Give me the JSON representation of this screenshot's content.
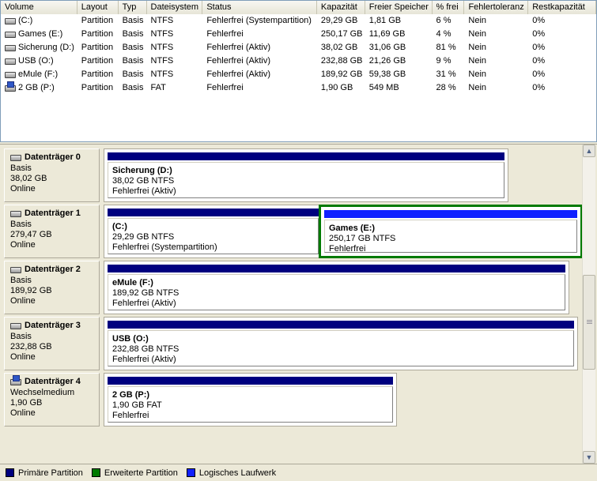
{
  "volumes": {
    "columns": [
      "Volume",
      "Layout",
      "Typ",
      "Dateisystem",
      "Status",
      "Kapazität",
      "Freier Speicher",
      "% frei",
      "Fehlertoleranz",
      "Restkapazität"
    ],
    "rows": [
      {
        "name": "(C:)",
        "icon": "hard-drive-icon",
        "layout": "Partition",
        "type": "Basis",
        "fs": "NTFS",
        "status": "Fehlerfrei (Systempartition)",
        "capacity": "29,29 GB",
        "free": "1,81 GB",
        "pct": "6 %",
        "fault": "Nein",
        "overhead": "0%"
      },
      {
        "name": "Games (E:)",
        "icon": "hard-drive-icon",
        "layout": "Partition",
        "type": "Basis",
        "fs": "NTFS",
        "status": "Fehlerfrei",
        "capacity": "250,17 GB",
        "free": "11,69 GB",
        "pct": "4 %",
        "fault": "Nein",
        "overhead": "0%"
      },
      {
        "name": "Sicherung (D:)",
        "icon": "hard-drive-icon",
        "layout": "Partition",
        "type": "Basis",
        "fs": "NTFS",
        "status": "Fehlerfrei (Aktiv)",
        "capacity": "38,02 GB",
        "free": "31,06 GB",
        "pct": "81 %",
        "fault": "Nein",
        "overhead": "0%"
      },
      {
        "name": "USB (O:)",
        "icon": "hard-drive-icon",
        "layout": "Partition",
        "type": "Basis",
        "fs": "NTFS",
        "status": "Fehlerfrei (Aktiv)",
        "capacity": "232,88 GB",
        "free": "21,26 GB",
        "pct": "9 %",
        "fault": "Nein",
        "overhead": "0%"
      },
      {
        "name": "eMule (F:)",
        "icon": "hard-drive-icon",
        "layout": "Partition",
        "type": "Basis",
        "fs": "NTFS",
        "status": "Fehlerfrei (Aktiv)",
        "capacity": "189,92 GB",
        "free": "59,38 GB",
        "pct": "31 %",
        "fault": "Nein",
        "overhead": "0%"
      },
      {
        "name": "2 GB (P:)",
        "icon": "removable-drive-icon",
        "layout": "Partition",
        "type": "Basis",
        "fs": "FAT",
        "status": "Fehlerfrei",
        "capacity": "1,90 GB",
        "free": "549 MB",
        "pct": "28 %",
        "fault": "Nein",
        "overhead": "0%"
      }
    ]
  },
  "disks": [
    {
      "title": "Datenträger 0",
      "icon": "hard-drive-icon",
      "kind": "Basis",
      "size": "38,02 GB",
      "state": "Online",
      "partitions": [
        {
          "name": "Sicherung  (D:)",
          "size": "38,02 GB NTFS",
          "status": "Fehlerfrei (Aktiv)",
          "kind": "primary"
        }
      ]
    },
    {
      "title": "Datenträger 1",
      "icon": "hard-drive-icon",
      "kind": "Basis",
      "size": "279,47 GB",
      "state": "Online",
      "partitions": [
        {
          "name": "(C:)",
          "size": "29,29 GB NTFS",
          "status": "Fehlerfrei (Systempartition)",
          "kind": "primary"
        },
        {
          "name": "Games  (E:)",
          "size": "250,17 GB NTFS",
          "status": "Fehlerfrei",
          "kind": "logical",
          "selected": true
        }
      ]
    },
    {
      "title": "Datenträger 2",
      "icon": "hard-drive-icon",
      "kind": "Basis",
      "size": "189,92 GB",
      "state": "Online",
      "partitions": [
        {
          "name": "eMule  (F:)",
          "size": "189,92 GB NTFS",
          "status": "Fehlerfrei (Aktiv)",
          "kind": "primary"
        }
      ]
    },
    {
      "title": "Datenträger 3",
      "icon": "hard-drive-icon",
      "kind": "Basis",
      "size": "232,88 GB",
      "state": "Online",
      "partitions": [
        {
          "name": "USB  (O:)",
          "size": "232,88 GB NTFS",
          "status": "Fehlerfrei (Aktiv)",
          "kind": "primary"
        }
      ]
    },
    {
      "title": "Datenträger 4",
      "icon": "removable-drive-icon",
      "kind": "Wechselmedium",
      "size": "1,90 GB",
      "state": "Online",
      "partitions": [
        {
          "name": "2 GB  (P:)",
          "size": "1,90 GB FAT",
          "status": "Fehlerfrei",
          "kind": "primary"
        }
      ]
    }
  ],
  "legend": [
    {
      "label": "Primäre Partition",
      "color": "#00007f"
    },
    {
      "label": "Erweiterte Partition",
      "color": "#007a00"
    },
    {
      "label": "Logisches Laufwerk",
      "color": "#1020ff"
    }
  ],
  "colors": {
    "primary": "#00007f",
    "logical": "#1020ff",
    "extended": "#007a00"
  },
  "scrollbar": {
    "up_icon": "scroll-up-arrow-icon",
    "down_icon": "scroll-down-arrow-icon"
  }
}
